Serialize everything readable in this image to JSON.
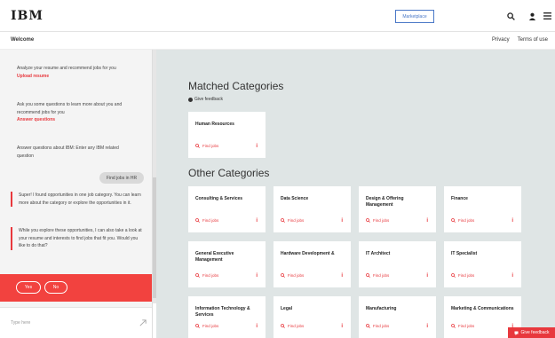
{
  "header": {
    "logo": "IBM",
    "marketplace_label": "Marketplace",
    "icons": [
      "search-icon",
      "user-icon",
      "menu-icon"
    ]
  },
  "subheader": {
    "welcome": "Welcome",
    "links": [
      "Privacy",
      "Terms of use"
    ]
  },
  "chat": {
    "intro": [
      {
        "text": "Analyze your resume and recommend jobs for you",
        "link": "Upload resume"
      },
      {
        "text": "Ask you some questions to learn more about you and recommend jobs for you",
        "link": "Answer questions"
      },
      {
        "text": "Answer questions about IBM: Enter any IBM related question",
        "link": ""
      }
    ],
    "user_message": "Find jobs in HR",
    "bot_messages": [
      "Super! I found opportunities in one job category. You can learn more about the category or explore the opportunities in it.",
      "While you explore these opportunities, I can also take a look at your resume and interests to find jobs that fit you. Would you like to do that?"
    ],
    "yes_label": "Yes",
    "no_label": "No",
    "input_placeholder": "Type here"
  },
  "main": {
    "matched_title": "Matched Categories",
    "give_feedback": "Give feedback",
    "matched": [
      {
        "title": "Human Resources",
        "find": "Find jobs"
      }
    ],
    "other_title": "Other Categories",
    "other": [
      {
        "title": "Consulting & Services",
        "find": "Find jobs"
      },
      {
        "title": "Data Science",
        "find": "Find jobs"
      },
      {
        "title": "Design & Offering Management",
        "find": "Find jobs"
      },
      {
        "title": "Finance",
        "find": "Find jobs"
      },
      {
        "title": "General Executive Management",
        "find": "Find jobs"
      },
      {
        "title": "Hardware Development &",
        "find": "Find jobs"
      },
      {
        "title": "IT Architect",
        "find": "Find jobs"
      },
      {
        "title": "IT Specialist",
        "find": "Find jobs"
      },
      {
        "title": "Information Technology & Services",
        "find": "Find jobs"
      },
      {
        "title": "Legal",
        "find": "Find jobs"
      },
      {
        "title": "Manufacturing",
        "find": "Find jobs"
      },
      {
        "title": "Marketing & Communications",
        "find": "Find jobs"
      }
    ]
  },
  "feedback_tab": "Give feedback",
  "colors": {
    "accent": "#e8383d",
    "panel": "#f2423f",
    "main_bg": "#dfe5e5"
  }
}
